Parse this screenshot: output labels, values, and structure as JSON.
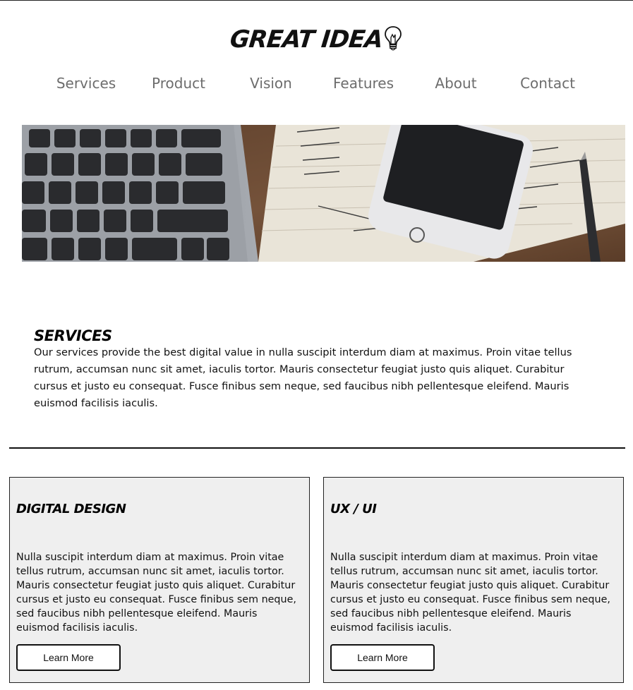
{
  "header": {
    "logo_text": "GREAT IDEA",
    "logo_icon": "lightbulb-icon"
  },
  "nav": {
    "items": [
      {
        "label": "Services"
      },
      {
        "label": "Product"
      },
      {
        "label": "Vision"
      },
      {
        "label": "Features"
      },
      {
        "label": "About"
      },
      {
        "label": "Contact"
      }
    ]
  },
  "hero": {
    "alt_description": "desk with keyboard, notebook, smartphone and pen"
  },
  "services": {
    "title": "SERVICES",
    "body": "Our services provide the best digital value in nulla suscipit interdum diam at maximus. Proin vitae tellus rutrum, accumsan nunc sit amet, iaculis tortor. Mauris consectetur feugiat justo quis aliquet. Curabitur cursus et justo eu consequat. Fusce finibus sem neque, sed faucibus nibh pellentesque eleifend. Mauris euismod facilisis iaculis."
  },
  "cards": [
    {
      "title": "DIGITAL DESIGN",
      "body": "Nulla suscipit interdum diam at maximus. Proin vitae tellus rutrum, accumsan nunc sit amet, iaculis tortor. Mauris consectetur feugiat justo quis aliquet. Curabitur cursus et justo eu consequat. Fusce finibus sem neque, sed faucibus nibh pellentesque eleifend. Mauris euismod facilisis iaculis.",
      "button_label": "Learn More"
    },
    {
      "title": "UX / UI",
      "body": "Nulla suscipit interdum diam at maximus. Proin vitae tellus rutrum, accumsan nunc sit amet, iaculis tortor. Mauris consectetur feugiat justo quis aliquet. Curabitur cursus et justo eu consequat. Fusce finibus sem neque, sed faucibus nibh pellentesque eleifend. Mauris euismod facilisis iaculis.",
      "button_label": "Learn More"
    }
  ],
  "colors": {
    "nav_text": "#6d6d6d",
    "card_background": "#efefef",
    "rule": "#111111"
  }
}
